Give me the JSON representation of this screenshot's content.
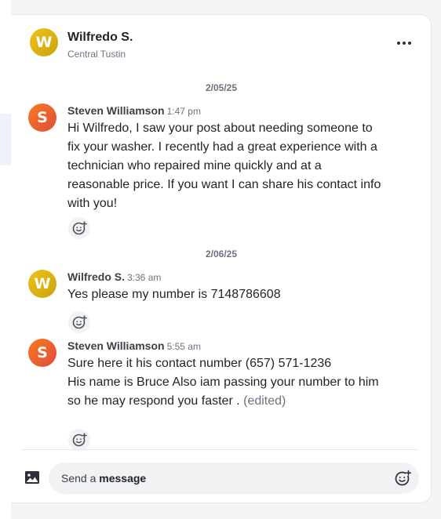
{
  "header": {
    "name": "Wilfredo S.",
    "location": "Central Tustin",
    "avatar_initial": "W",
    "more_icon": "more-horizontal-icon"
  },
  "conversation": {
    "dates": [
      "2/05/25",
      "2/06/25"
    ],
    "messages": [
      {
        "author": "Steven Williamson",
        "time": "1:47 pm",
        "avatar_initial": "S",
        "avatar_color": "#f06a2a",
        "text": "Hi Wilfredo, I saw your post about needing someone to fix your washer. I recently had a great experience with a technician who repaired mine quickly and at a reasonable price. If you want I can share his contact info with you!"
      },
      {
        "author": "Wilfredo S.",
        "time": "3:36 am",
        "avatar_initial": "W",
        "avatar_color": "#e0b416",
        "text": "Yes please my number is 7148786608"
      },
      {
        "author": "Steven Williamson",
        "time": "5:55 am",
        "avatar_initial": "S",
        "avatar_color": "#f06a2a",
        "text_line1": "Sure here it his contact number (657) 571-1236",
        "text_line2": "His name is Bruce Also iam passing your number to him so he may respond you faster .",
        "edited_label": "(edited)"
      }
    ],
    "reaction_icon": "add-reaction-icon"
  },
  "composer": {
    "hint_prefix": "Send a ",
    "hint_bold": "message",
    "photo_icon": "image-icon",
    "emoji_icon": "emoji-add-icon"
  }
}
